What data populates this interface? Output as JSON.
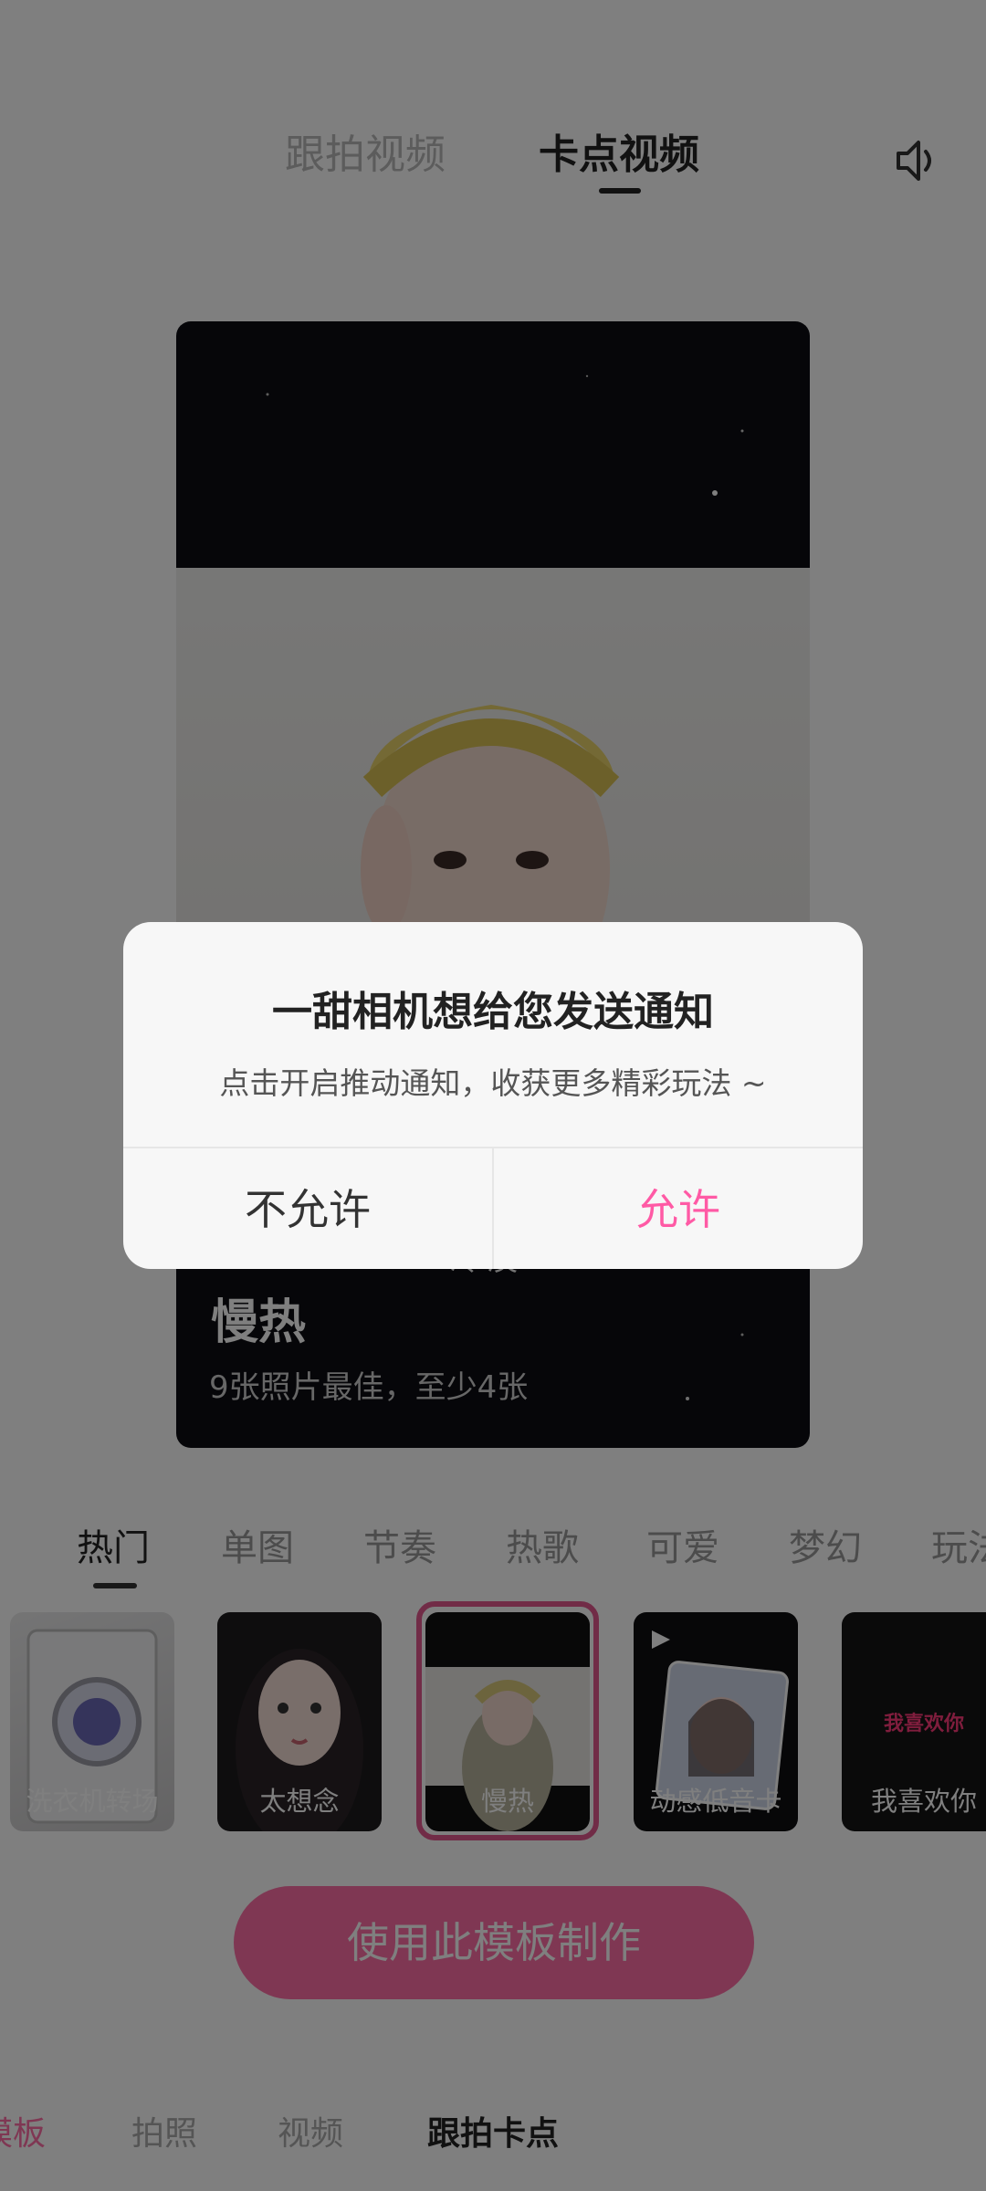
{
  "top_tabs": [
    {
      "label": "跟拍视频"
    },
    {
      "label": "卡点视频"
    }
  ],
  "preview": {
    "title": "慢热",
    "subtitle": "9张照片最佳，至少4张",
    "script_text": "冷漠"
  },
  "categories": [
    "热门",
    "单图",
    "节奏",
    "热歌",
    "可爱",
    "梦幻",
    "玩法"
  ],
  "thumbnails": [
    {
      "label": "洗衣机转场"
    },
    {
      "label": "太想念"
    },
    {
      "label": "慢热"
    },
    {
      "label": "动感低音卡"
    },
    {
      "label": "我喜欢你",
      "overlay_text": "我喜欢你"
    }
  ],
  "make_button": {
    "label": "使用此模板制作"
  },
  "bottom_nav": [
    {
      "label": "模板"
    },
    {
      "label": "拍照"
    },
    {
      "label": "视频"
    },
    {
      "label": "跟拍卡点"
    }
  ],
  "dialog": {
    "title": "一甜相机想给您发送通知",
    "message": "点击开启推动通知，收获更多精彩玩法 ~",
    "deny_label": "不允许",
    "allow_label": "允许"
  },
  "colors": {
    "accent": "#ff6fa6",
    "allow_text": "#ff5aa5",
    "selected_frame": "#e2588f"
  }
}
